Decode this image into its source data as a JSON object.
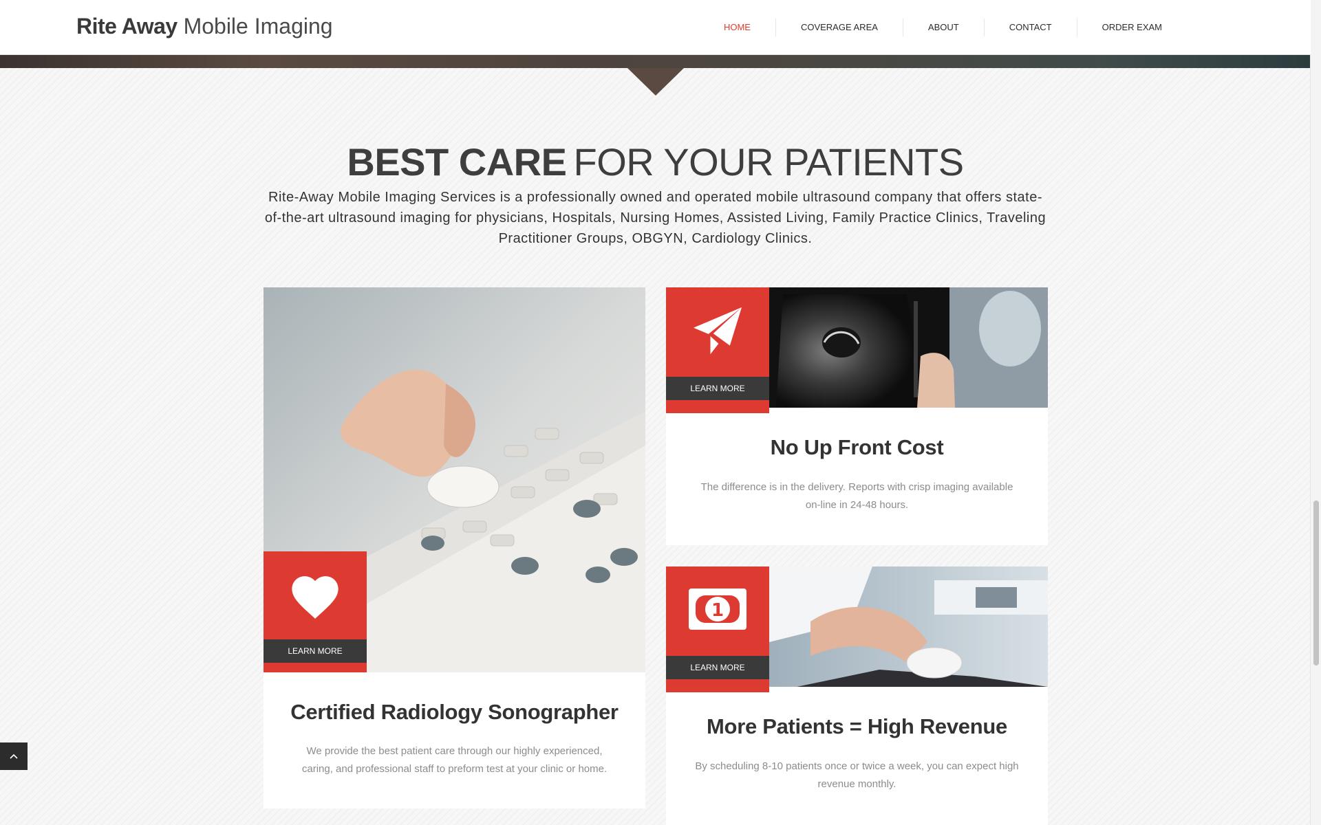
{
  "header": {
    "logo_bold": "Rite Away",
    "logo_light": "Mobile Imaging",
    "nav": [
      "HOME",
      "COVERAGE AREA",
      "ABOUT",
      "CONTACT",
      "ORDER EXAM"
    ],
    "active": "HOME"
  },
  "section": {
    "title_bold": "BEST CARE",
    "title_light": "FOR YOUR PATIENTS",
    "intro": "Rite-Away Mobile Imaging Services is a professionally owned and operated mobile ultrasound company that offers state-of-the-art ultrasound imaging for physicians, Hospitals, Nursing Homes, Assisted Living, Family Practice Clinics, Traveling Practitioner Groups, OBGYN, Cardiology Clinics."
  },
  "cards": [
    {
      "title": "Certified Radiology Sonographer",
      "text": "We provide the best patient care through our highly experienced, caring, and professional staff to preform test at your clinic or home.",
      "button": "LEARN MORE",
      "icon": "heart-icon"
    },
    {
      "title": "No Up Front Cost",
      "text": "The difference is in the delivery. Reports with crisp imaging available on-line in 24-48 hours.",
      "button": "LEARN MORE",
      "icon": "paper-plane-icon"
    },
    {
      "title": "More Patients = High Revenue",
      "text": "By scheduling 8-10 patients once or twice a week, you can expect high revenue monthly.",
      "button": "LEARN MORE",
      "icon": "dollar-bill-icon"
    }
  ],
  "colors": {
    "accent": "#dd3b31",
    "dark_button": "#3a3a3a",
    "text": "#333333"
  },
  "icons": {
    "back_to_top": "chevron-up-icon"
  }
}
